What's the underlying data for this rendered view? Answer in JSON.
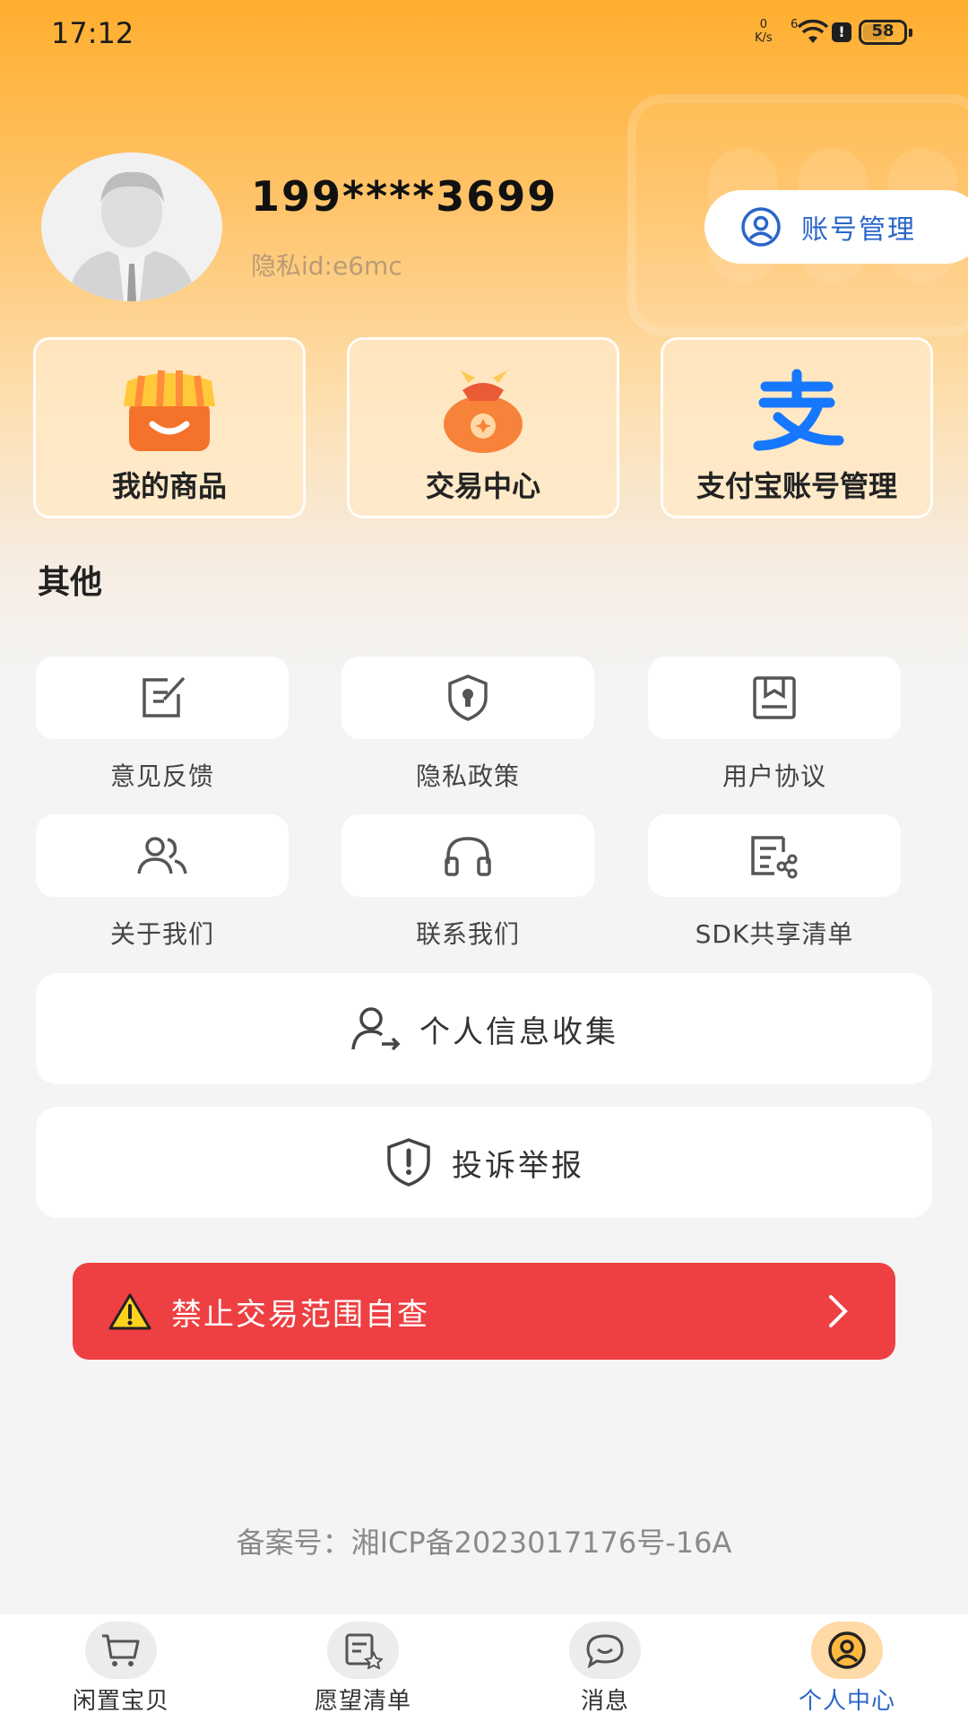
{
  "status_bar": {
    "time": "17:12",
    "net_speed_value": "0",
    "net_speed_unit": "K/s",
    "signal_label": "6",
    "battery": "58"
  },
  "profile": {
    "phone": "199****3699",
    "privacy_id": "隐私id:e6mc",
    "account_button": "账号管理"
  },
  "quick_cards": [
    {
      "label": "我的商品",
      "icon": "shop-icon"
    },
    {
      "label": "交易中心",
      "icon": "money-bag-icon"
    },
    {
      "label": "支付宝账号管理",
      "icon": "alipay-icon"
    }
  ],
  "section_title": "其他",
  "grid": [
    {
      "label": "意见反馈",
      "icon": "edit-note-icon"
    },
    {
      "label": "隐私政策",
      "icon": "shield-lock-icon"
    },
    {
      "label": "用户协议",
      "icon": "document-icon"
    },
    {
      "label": "关于我们",
      "icon": "users-icon"
    },
    {
      "label": "联系我们",
      "icon": "headset-icon"
    },
    {
      "label": "SDK共享清单",
      "icon": "share-list-icon"
    }
  ],
  "buttons": {
    "personal_info": "个人信息收集",
    "complaint": "投诉举报"
  },
  "banner": {
    "text": "禁止交易范围自查"
  },
  "icp": "备案号：湘ICP备2023017176号-16A",
  "tabs": [
    {
      "label": "闲置宝贝",
      "icon": "cart-icon"
    },
    {
      "label": "愿望清单",
      "icon": "wishlist-icon"
    },
    {
      "label": "消息",
      "icon": "chat-icon"
    },
    {
      "label": "个人中心",
      "icon": "profile-icon"
    }
  ],
  "colors": {
    "accent_blue": "#2a66c8",
    "banner_red": "#ee3f42",
    "header_orange": "#ffae2e"
  }
}
